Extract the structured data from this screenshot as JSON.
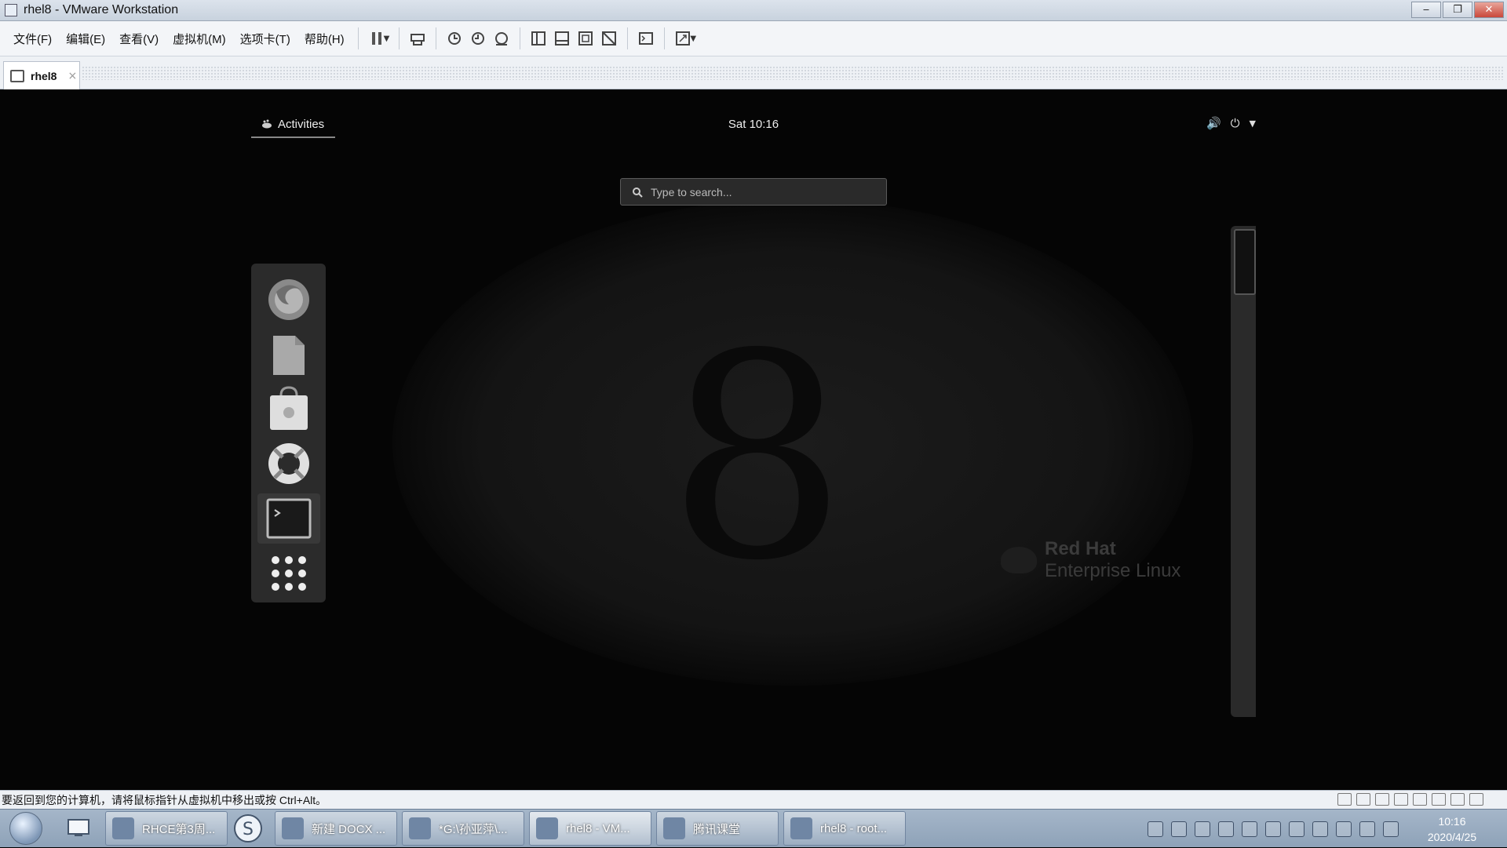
{
  "window": {
    "title": "rhel8 - VMware Workstation",
    "buttons": {
      "minimize": "‒",
      "restore": "❐",
      "close": "✕"
    }
  },
  "menu": [
    {
      "label": "文件(F)"
    },
    {
      "label": "编辑(E)"
    },
    {
      "label": "查看(V)"
    },
    {
      "label": "虚拟机(M)"
    },
    {
      "label": "选项卡(T)"
    },
    {
      "label": "帮助(H)"
    }
  ],
  "vm_tab": {
    "label": "rhel8",
    "close": "×"
  },
  "gnome": {
    "activities": "Activities",
    "clock": "Sat 10:16",
    "search_placeholder": "Type to search...",
    "dash": [
      {
        "name": "firefox-icon"
      },
      {
        "name": "files-icon"
      },
      {
        "name": "software-icon"
      },
      {
        "name": "help-icon"
      },
      {
        "name": "terminal-icon"
      },
      {
        "name": "show-apps-icon"
      }
    ],
    "branding": {
      "line1": "Red Hat",
      "line2": "Enterprise Linux"
    }
  },
  "status_bar": {
    "message": "要返回到您的计算机，请将鼠标指针从虚拟机中移出或按 Ctrl+Alt。"
  },
  "taskbar": {
    "items": [
      {
        "label": "RHCE第3周...",
        "active": false
      },
      {
        "label": "新建 DOCX ...",
        "active": false
      },
      {
        "label": "*G:\\孙亚萍\\...",
        "active": false
      },
      {
        "label": "rhel8 - VM...",
        "active": true
      },
      {
        "label": "腾讯课堂",
        "active": false
      },
      {
        "label": "rhel8 - root...",
        "active": false
      }
    ],
    "clock_time": "10:16",
    "clock_date": "2020/4/25"
  }
}
